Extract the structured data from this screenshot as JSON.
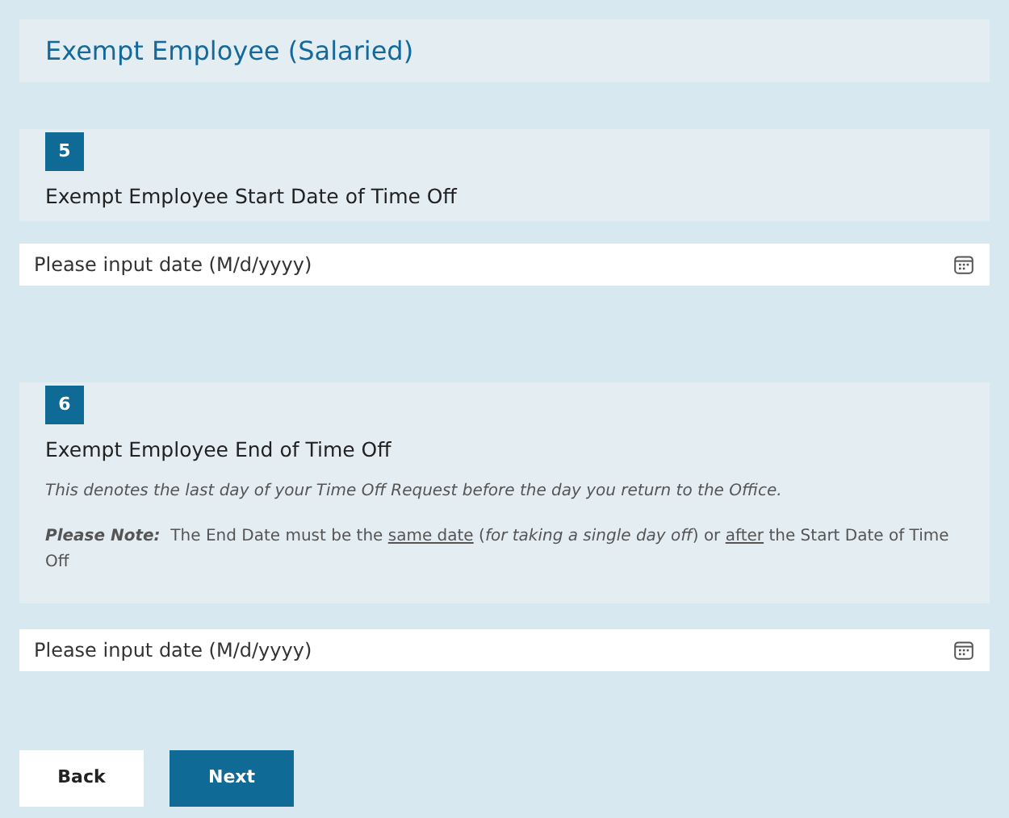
{
  "section_title": "Exempt Employee (Salaried)",
  "questions": [
    {
      "number": "5",
      "title": "Exempt Employee Start Date of Time Off",
      "input": {
        "placeholder": "Please input date (M/d/yyyy)"
      }
    },
    {
      "number": "6",
      "title": "Exempt Employee End of Time Off",
      "description": "This denotes the last day of your Time Off Request before the day you return to the Office.",
      "note": [
        {
          "kind": "bolditalic",
          "text": "Please Note:"
        },
        {
          "kind": "plain",
          "text": "  The End Date must be the "
        },
        {
          "kind": "underline",
          "text": "same date"
        },
        {
          "kind": "plain",
          "text": " ("
        },
        {
          "kind": "italic",
          "text": "for taking a single day off"
        },
        {
          "kind": "plain",
          "text": ") or "
        },
        {
          "kind": "underline",
          "text": "after"
        },
        {
          "kind": "plain",
          "text": " the Start Date of Time Off"
        }
      ],
      "input": {
        "placeholder": "Please input date (M/d/yyyy)"
      }
    }
  ],
  "buttons": [
    {
      "label": "Back",
      "kind": "secondary"
    },
    {
      "label": "Next",
      "kind": "primary"
    }
  ]
}
